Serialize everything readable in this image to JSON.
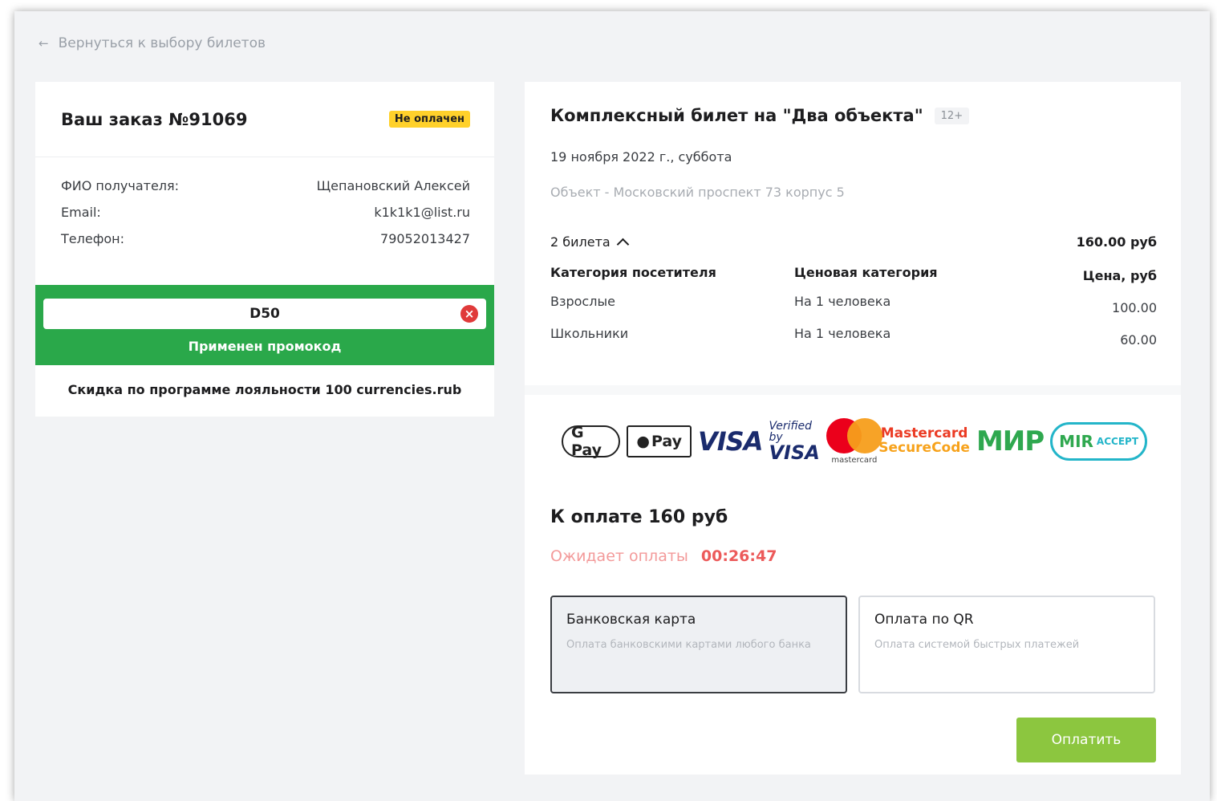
{
  "back_link": {
    "label": "Вернуться к выбору билетов"
  },
  "order": {
    "title": "Ваш заказ №91069",
    "status": "Не оплачен",
    "fields": [
      {
        "label": "ФИО получателя:",
        "value": "Щепановский Алексей"
      },
      {
        "label": "Email:",
        "value": "k1k1k1@list.ru"
      },
      {
        "label": "Телефон:",
        "value": "79052013427"
      }
    ],
    "promo": {
      "code": "D50",
      "message": "Применен промокод"
    },
    "loyalty_discount": "Скидка по программе лояльности 100 currencies.rub"
  },
  "ticket": {
    "title": "Комплексный билет на \"Два объекта\"",
    "age": "12+",
    "date": "19 ноября 2022 г., суббота",
    "venue": "Объект - Московский проспект 73 корпус 5",
    "count_label": "2 билета",
    "total": "160.00 руб",
    "table": {
      "headers": [
        "Категория посетителя",
        "Ценовая категория",
        "Цена, руб"
      ],
      "rows": [
        [
          "Взрослые",
          "На 1 человека",
          "100.00"
        ],
        [
          "Школьники",
          "На 1 человека",
          "60.00"
        ]
      ]
    }
  },
  "payment": {
    "logos": {
      "gpay": "G Pay",
      "applepay": "Pay",
      "visa": "VISA",
      "vbv_top": "Verified by",
      "vbv_bottom": "VISA",
      "mastercard": "mastercard",
      "mcsc_top": "Mastercard",
      "mcsc_bottom": "SecureCode",
      "mir": "МИР",
      "mir_accept_a": "MIR",
      "mir_accept_b": "ACCEPT"
    },
    "to_pay": "К оплате 160 руб",
    "awaiting_label": "Ожидает оплаты",
    "timer": "00:26:47",
    "options": [
      {
        "title": "Банковская карта",
        "desc": "Оплата банковскими картами любого банка",
        "selected": true
      },
      {
        "title": "Оплата по QR",
        "desc": "Оплата системой быстрых платежей",
        "selected": false
      }
    ],
    "pay_button": "Оплатить"
  },
  "colors": {
    "status_badge": "#ffd12b",
    "promo_green": "#2aa84a",
    "pay_button": "#8cc63f",
    "awaiting": "#f39a9a",
    "timer": "#ec5a5a"
  }
}
